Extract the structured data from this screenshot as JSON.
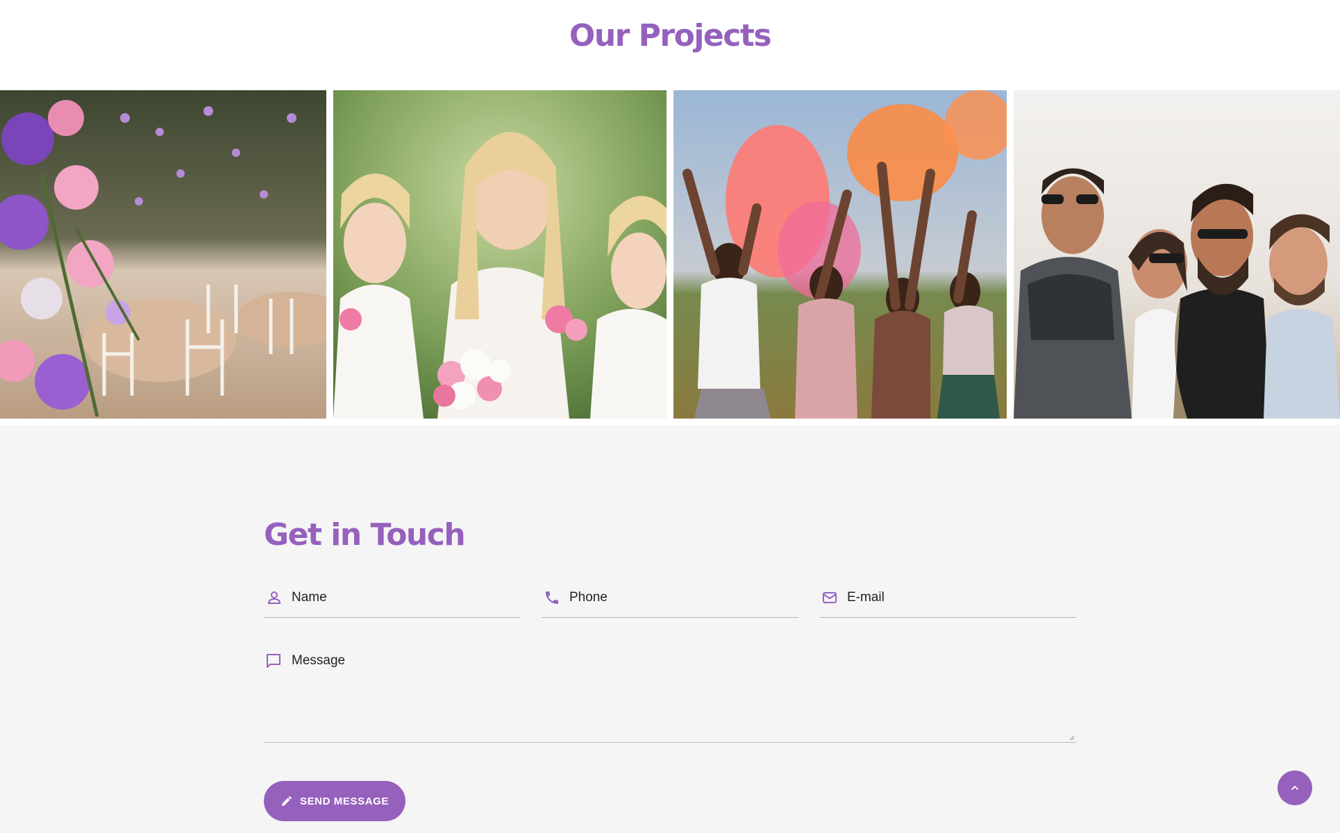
{
  "projects": {
    "title": "Our Projects",
    "items": [
      {
        "image": "wedding-reception-flowers"
      },
      {
        "image": "bride-with-flower-girls"
      },
      {
        "image": "color-powder-festival"
      },
      {
        "image": "friends-laughing-outdoors"
      }
    ]
  },
  "contact": {
    "title": "Get in Touch",
    "fields": {
      "name": {
        "placeholder": "Name",
        "icon": "person-icon"
      },
      "phone": {
        "placeholder": "Phone",
        "icon": "phone-icon"
      },
      "email": {
        "placeholder": "E-mail",
        "icon": "mail-icon"
      },
      "message": {
        "placeholder": "Message",
        "icon": "chat-icon"
      }
    },
    "send_label": "SEND MESSAGE",
    "send_icon": "pencil-icon"
  },
  "scroll_top": {
    "icon": "chevron-up-icon"
  },
  "colors": {
    "accent": "#9561bd",
    "background": "#f5f5f5"
  }
}
